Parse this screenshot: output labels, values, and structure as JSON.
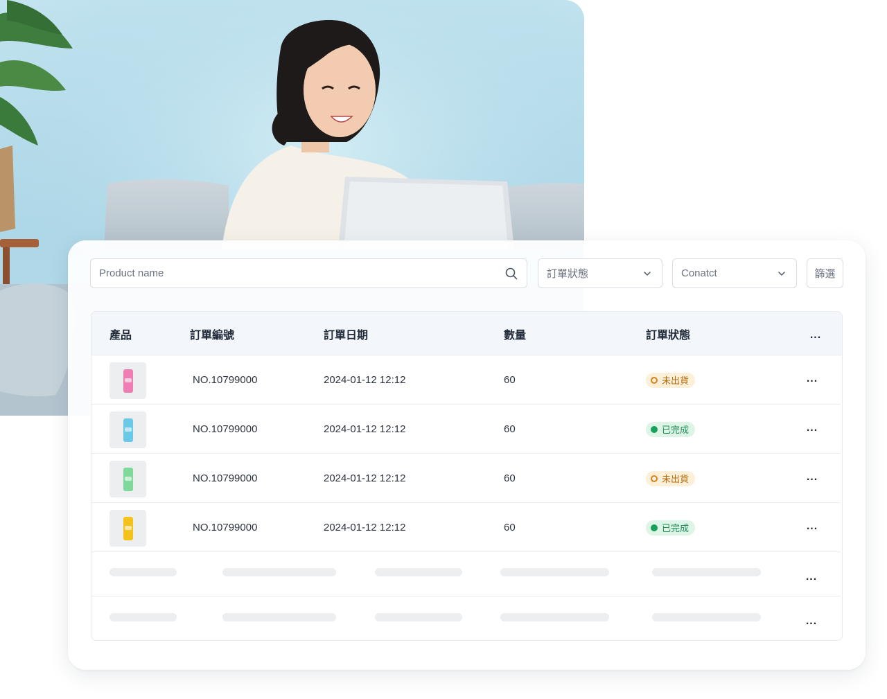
{
  "search": {
    "placeholder": "Product name"
  },
  "filters": {
    "status_label": "訂單狀態",
    "contact_label": "Conatct",
    "filter_button": "篩選"
  },
  "table": {
    "headers": {
      "product": "產品",
      "order_no": "訂單編號",
      "order_date": "訂單日期",
      "quantity": "數量",
      "status": "訂單狀態",
      "more": "..."
    },
    "rows": [
      {
        "thumb_color": "#ee7fb4",
        "order_no": "NO.10799000",
        "date": "2024-01-12 12:12",
        "qty": "60",
        "status": "未出貨",
        "status_type": "pending"
      },
      {
        "thumb_color": "#6ac9e6",
        "order_no": "NO.10799000",
        "date": "2024-01-12 12:12",
        "qty": "60",
        "status": "已完成",
        "status_type": "done"
      },
      {
        "thumb_color": "#7fd99a",
        "order_no": "NO.10799000",
        "date": "2024-01-12 12:12",
        "qty": "60",
        "status": "未出貨",
        "status_type": "pending"
      },
      {
        "thumb_color": "#f4c21a",
        "order_no": "NO.10799000",
        "date": "2024-01-12 12:12",
        "qty": "60",
        "status": "已完成",
        "status_type": "done"
      }
    ],
    "more_label": "..."
  }
}
